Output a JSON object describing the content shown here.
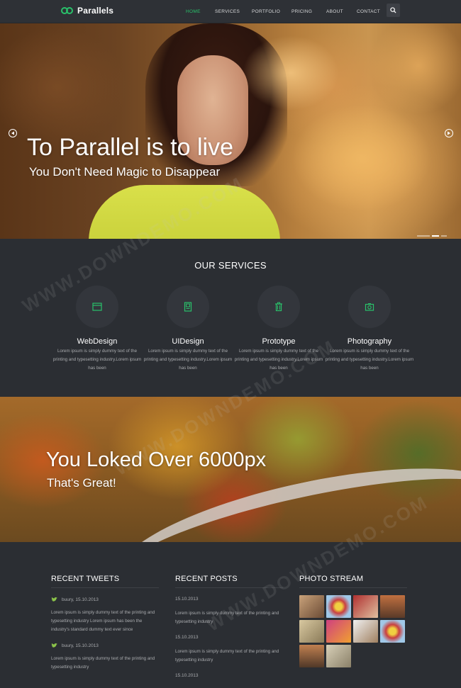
{
  "header": {
    "logo_text": "Parallels",
    "nav": [
      "HOME",
      "SERVICES",
      "PORTFOLIO",
      "PRICING",
      "ABOUT",
      "CONTACT"
    ],
    "active_nav": "HOME",
    "accent": "#29c06a"
  },
  "hero": {
    "title": "To Parallel is to live",
    "subtitle": "You Don't Need Magic to Disappear",
    "slides": 3,
    "active_slide": 1
  },
  "services": {
    "title": "OUR SERVICES",
    "items": [
      {
        "name": "WebDesign",
        "icon": "browser-window-icon",
        "text": "Lorem ipsum is simply dummy text of the printing and typesetting industry.Lorem ipsum has been"
      },
      {
        "name": "UIDesign",
        "icon": "mobile-layout-icon",
        "text": "Lorem ipsum is simply dummy text of the printing and typesetting industry.Lorem ipsum has been"
      },
      {
        "name": "Prototype",
        "icon": "trash-icon",
        "text": "Lorem ipsum is simply dummy text of the printing and typesetting industry.Lorem ipsum has been"
      },
      {
        "name": "Photography",
        "icon": "camera-icon",
        "text": "Lorem ipsum is simply dummy text of the printing and typesetting industry.Lorem ipsum has been"
      }
    ]
  },
  "parallax": {
    "title": "You Loked Over 6000px",
    "subtitle": "That's Great!"
  },
  "footer": {
    "tweets": {
      "title": "RECENT TWEETS",
      "items": [
        {
          "meta": "buury, 15.10.2013",
          "text": "Lorem ipsum is simply dummy text of the printing and typesetting industry Lorem ipsum has been the industry's standard dummy text ever since"
        },
        {
          "meta": "buury, 15.10.2013",
          "text": "Lorem ipsum is simply dummy text of the printing and typesetting industry"
        }
      ]
    },
    "posts": {
      "title": "RECENT POSTS",
      "items": [
        {
          "date": "15.10.2013",
          "text": "Lorem ipsum is simply dummy text of the printing and typesetting industry"
        },
        {
          "date": "15.10.2013",
          "text": "Lorem ipsum is simply dummy text of the printing and typesetting industry"
        },
        {
          "date": "15.10.2013",
          "text": ""
        }
      ]
    },
    "photos": {
      "title": "PHOTO STREAM",
      "count": 10
    }
  },
  "watermark": "WWW.DOWNDEMO.COM"
}
